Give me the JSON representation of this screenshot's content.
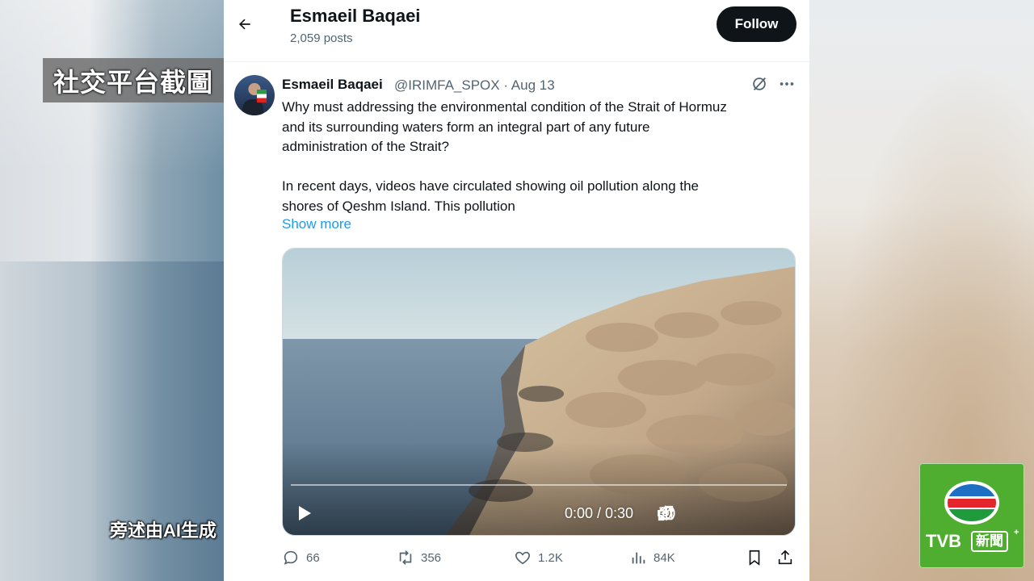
{
  "overlay": {
    "caption": "社交平台截圖",
    "narration": "旁述由AI生成",
    "tvb_logo": "TVB",
    "tvb_news": "新聞",
    "tvb_plus": "+"
  },
  "header": {
    "name": "Esmaeil Baqaei",
    "posts": "2,059 posts",
    "follow_label": "Follow"
  },
  "tweet": {
    "author": "Esmaeil Baqaei",
    "handle_date": "@IRIMFA_SPOX · Aug 13",
    "body": "Why must addressing the environmental condition of the Strait of Hormuz\nand its surrounding waters form an integral part of any future\nadministration of the Strait?\n\nIn recent days, videos have circulated showing oil pollution along the\nshores of Qeshm Island. This pollution",
    "show_more": "Show more",
    "video": {
      "time": "0:00 / 0:30",
      "progress": 0
    }
  },
  "actions": {
    "replies": "66",
    "reposts": "356",
    "likes": "1.2K",
    "views": "84K"
  },
  "colors": {
    "accent": "#1d9bf0",
    "text": "#0f1419",
    "muted": "#536471",
    "tvb_green": "#4fae2f"
  },
  "icons": [
    "back-arrow-icon",
    "grok-icon",
    "more-icon",
    "play-icon",
    "volume-icon",
    "settings-icon",
    "minimize-icon",
    "fullscreen-icon",
    "reply-icon",
    "repost-icon",
    "like-icon",
    "views-icon",
    "bookmark-icon",
    "share-icon"
  ]
}
